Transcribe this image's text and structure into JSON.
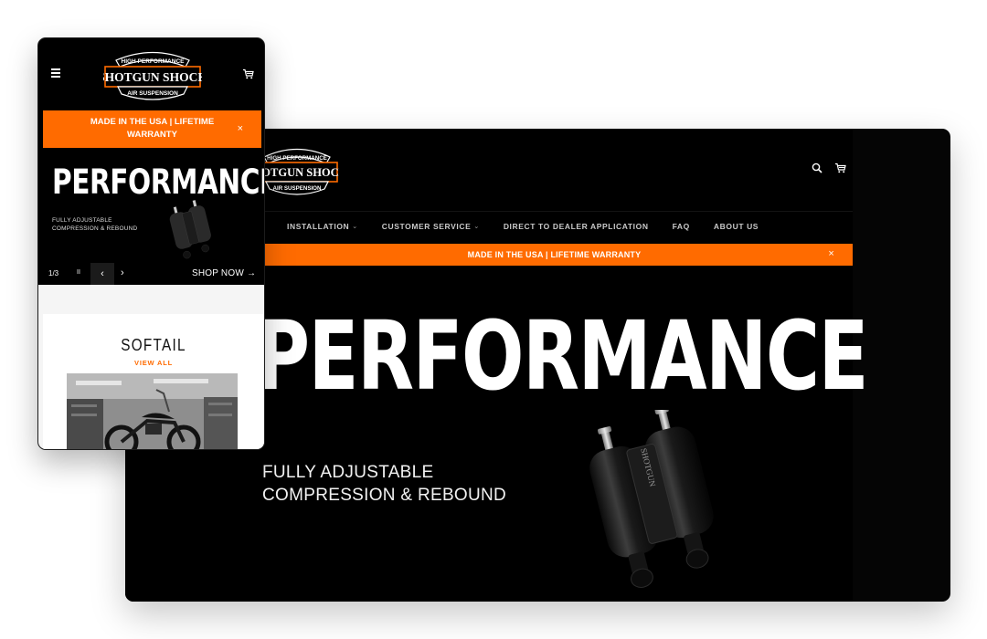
{
  "brand": {
    "top_line": "HIGH PERFORMANCE",
    "name": "SHOTGUN SHOCK",
    "bottom_line": "AIR SUSPENSION",
    "accent_color": "#ff6b00"
  },
  "desktop": {
    "nav": [
      {
        "label": "INSTALLATION",
        "has_dropdown": true
      },
      {
        "label": "CUSTOMER SERVICE",
        "has_dropdown": true
      },
      {
        "label": "DIRECT TO DEALER APPLICATION",
        "has_dropdown": false
      },
      {
        "label": "FAQ",
        "has_dropdown": false
      },
      {
        "label": "ABOUT US",
        "has_dropdown": false
      }
    ],
    "banner": "MADE IN THE USA | LIFETIME WARRANTY",
    "banner_close": "×",
    "hero": {
      "title": "PERFORMANCE",
      "subtitle_line1": "FULLY ADJUSTABLE",
      "subtitle_line2": "COMPRESSION & REBOUND"
    },
    "icons": [
      "search-icon",
      "cart-icon"
    ]
  },
  "mobile": {
    "banner": "MADE IN THE USA | LIFETIME WARRANTY",
    "banner_close": "×",
    "hero": {
      "title": "PERFORMANCE",
      "subtitle_line1": "FULLY ADJUSTABLE",
      "subtitle_line2": "COMPRESSION & REBOUND"
    },
    "slider": {
      "counter": "1/3",
      "pause": "II",
      "prev": "‹",
      "next": "›",
      "shop_now": "SHOP NOW →"
    },
    "collection": {
      "title": "SOFTAIL",
      "view_all": "VIEW ALL"
    },
    "icons": [
      "menu-icon",
      "cart-icon"
    ]
  }
}
